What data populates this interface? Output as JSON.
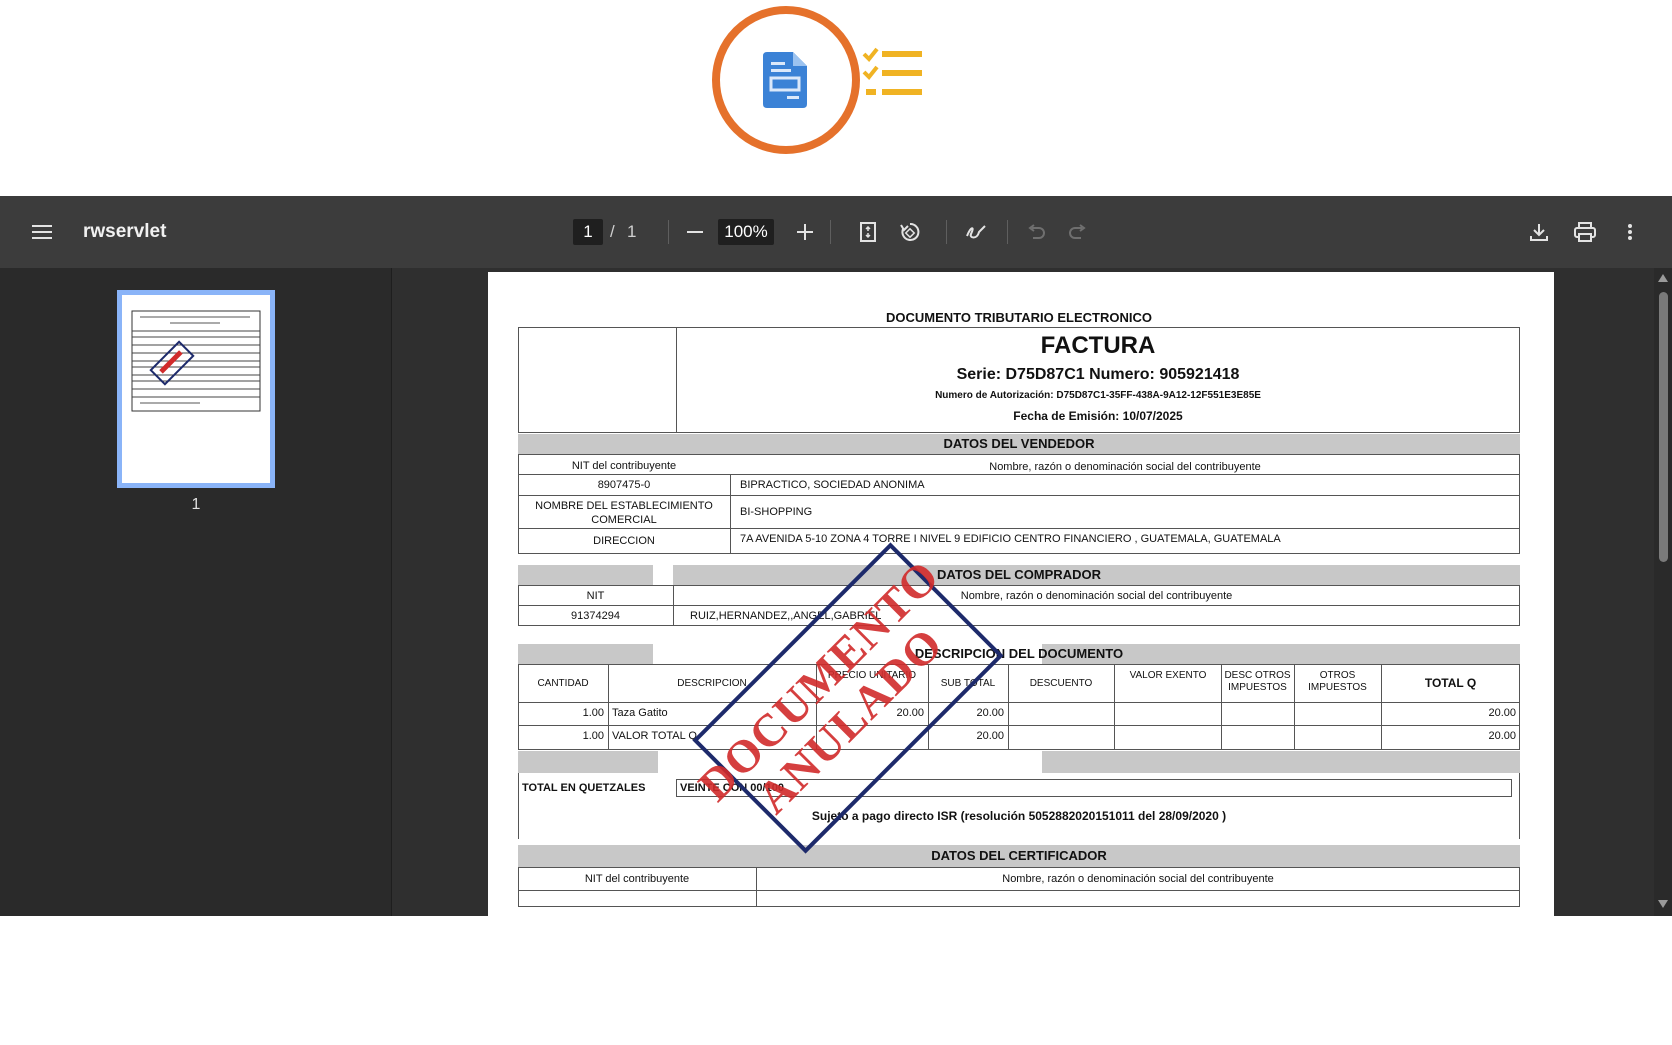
{
  "viewer": {
    "title": "rwservlet",
    "page_current": "1",
    "page_separator": "/",
    "page_total": "1",
    "zoom": "100%",
    "thumbnail_page": "1"
  },
  "invoice": {
    "doc_type": "DOCUMENTO TRIBUTARIO ELECTRONICO",
    "title": "FACTURA",
    "serie_numero": "Serie: D75D87C1  Numero: 905921418",
    "autorizacion": "Numero de Autorización: D75D87C1-35FF-438A-9A12-12F551E3E85E",
    "fecha": "Fecha de Emisión: 10/07/2025",
    "vendedor_header": "DATOS DEL VENDEDOR",
    "nit_label": "NIT del contribuyente",
    "nombre_label": "Nombre, razón o denominación social del contribuyente",
    "vendedor_nit": "8907475-0",
    "vendedor_nombre": "BIPRACTICO, SOCIEDAD ANONIMA",
    "establecimiento_label_1": "NOMBRE DEL ESTABLECIMIENTO",
    "establecimiento_label_2": "COMERCIAL",
    "establecimiento": "BI-SHOPPING",
    "direccion_label": "DIRECCION",
    "direccion": "7A AVENIDA 5-10  ZONA 4 TORRE I NIVEL 9 EDIFICIO CENTRO FINANCIERO , GUATEMALA, GUATEMALA",
    "comprador_header": "DATOS DEL COMPRADOR",
    "comprador_nit_label": "NIT",
    "comprador_nombre_label": "Nombre, razón o denominación social del contribuyente",
    "comprador_nit": "91374294",
    "comprador_nombre": "RUIZ,HERNANDEZ,,ANGEL,GABRIEL",
    "descripcion_header": "DESCRIPCION DEL DOCUMENTO",
    "columns": [
      "CANTIDAD",
      "DESCRIPCION",
      "PRECIO UNITARIO",
      "SUB TOTAL",
      "DESCUENTO",
      "VALOR EXENTO",
      "DESC OTROS IMPUESTOS",
      "OTROS IMPUESTOS",
      "TOTAL Q"
    ],
    "rows": [
      {
        "cantidad": "1.00",
        "descripcion": "Taza Gatito",
        "precio": "20.00",
        "subtotal": "20.00",
        "total": "20.00"
      },
      {
        "cantidad": "1.00",
        "descripcion": "VALOR TOTAL Q",
        "precio": "",
        "subtotal": "20.00",
        "total": "20.00"
      }
    ],
    "total_label": "TOTAL EN QUETZALES",
    "total_words": "VEINTE CON 00/100",
    "isr_note": "Sujeto a pago directo ISR (resolución 5052882020151011 del 28/09/2020 )",
    "certificador_header": "DATOS DEL CERTIFICADOR",
    "cert_nit_label": "NIT del contribuyente",
    "cert_nombre_label": "Nombre, razón o denominación social del contribuyente",
    "stamp_line1": "DOCUMENTO",
    "stamp_line2": "ANULADO"
  },
  "colors": {
    "highlight_ring": "#e5712b",
    "doc_icon": "#3b82d6",
    "checklist_icon": "#f0b323",
    "stamp_border": "#1d2a6b",
    "stamp_text": "#d12b2b"
  }
}
